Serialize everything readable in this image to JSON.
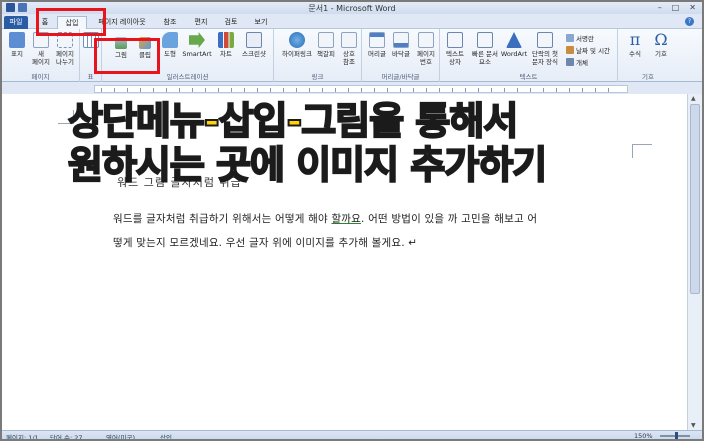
{
  "window": {
    "title": "문서1 - Microsoft Word",
    "controls": [
      "–",
      "□",
      "✕"
    ]
  },
  "tabs": [
    {
      "label": "파일",
      "type": "file"
    },
    {
      "label": "홈"
    },
    {
      "label": "삽입",
      "active": true
    },
    {
      "label": "페이지 레이아웃"
    },
    {
      "label": "참조"
    },
    {
      "label": "편지"
    },
    {
      "label": "검토"
    },
    {
      "label": "보기"
    }
  ],
  "ribbon": {
    "groups": {
      "pages": "페이지",
      "table": "표",
      "illustrations": "일러스트레이션",
      "links": "링크",
      "header_footer": "머리글/바닥글",
      "text": "텍스트",
      "symbols": "기호"
    },
    "buttons": {
      "cover": [
        "표지",
        ""
      ],
      "blank": [
        "새",
        "페이지"
      ],
      "pagebreak": [
        "페이지",
        "나누기"
      ],
      "table": [
        "표",
        ""
      ],
      "picture": "그림",
      "clipart": "클립",
      "shapes": "도형",
      "smartart": "SmartArt",
      "chart": "차트",
      "screenshot": "스크린샷",
      "hyperlink": "하이퍼링크",
      "bookmark": "책갈피",
      "crossref": [
        "상호",
        "참조"
      ],
      "header": "머리글",
      "footer": "바닥글",
      "pagenumber": [
        "페이지",
        "번호"
      ],
      "textbox": [
        "텍스트",
        "상자"
      ],
      "quickparts": [
        "빠른 문서",
        "요소"
      ],
      "wordart": "WordArt",
      "dropcap": [
        "단락의 첫",
        "문자 장식"
      ],
      "signature": "서명란",
      "datetime": "날짜 및 시간",
      "object": "개체",
      "equation": "수식",
      "symbol": "기호"
    }
  },
  "document": {
    "overlay_line1": "상단메뉴-삽입-그림을 통해서",
    "overlay_line2": "원하시는 곳에 이미지 추가하기",
    "partial_line": "워드 그림 글자처럼 취급",
    "para1_a": "워드를 글자처럼 취급하기 위해서는 어떻게 해야 ",
    "para1_b": "할까요",
    "para1_c": ". 어떤 방법이 있을 까 고민을 해보고 어",
    "para2": "떻게 맞는지 모르겠네요. 우선 글자 위에 이미지를 추가해 볼게요. ↵"
  },
  "statusbar": {
    "page": "페이지: 1/1",
    "words": "단어 수: 27",
    "lang": "영어(미국)",
    "mode": "삽입",
    "zoom": "150%"
  }
}
